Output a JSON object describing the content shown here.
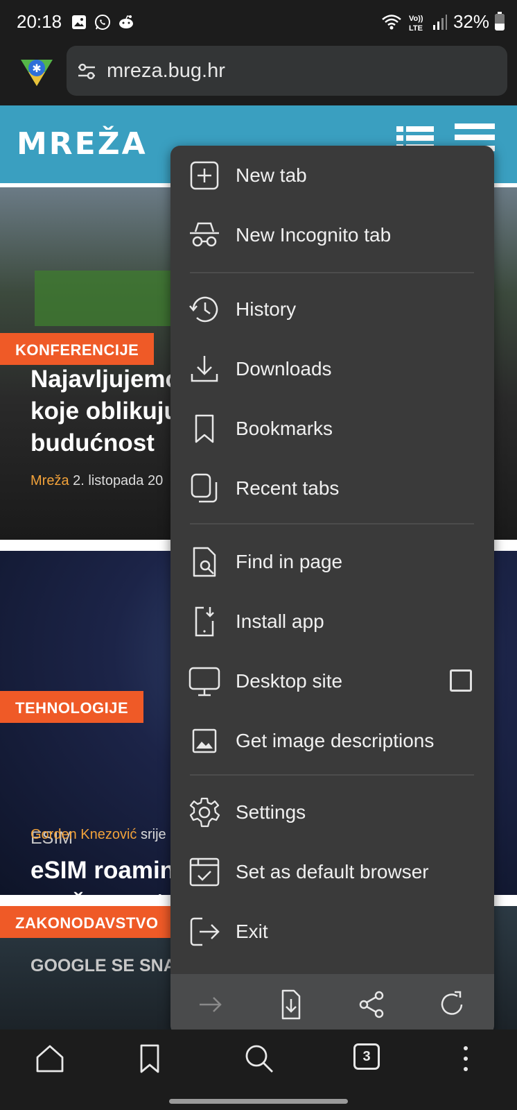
{
  "status_bar": {
    "time": "20:18",
    "battery": "32%",
    "network_label": "LTE"
  },
  "toolbar": {
    "url": "mreza.bug.hr"
  },
  "site": {
    "logo_text": "MREŽA",
    "articles": [
      {
        "category": "KONFERENCIJE",
        "title": "Najavljujemo\nkoje oblikuju\nbudućnost",
        "author": "Mreža",
        "date": " 2. listopada 20"
      },
      {
        "category": "TEHNOLOGIJE",
        "subcategory": "ESIM",
        "title": "eSIM roaming\nsnažan rast",
        "author": "Gorden Knezović",
        "date": " srije"
      },
      {
        "category": "ZAKONODAVSTVO",
        "peek_title": "GOOGLE SE SNA"
      }
    ]
  },
  "menu": {
    "items": [
      {
        "label": "New tab",
        "icon": "new-tab-icon"
      },
      {
        "label": "New Incognito tab",
        "icon": "incognito-icon"
      },
      {
        "label": "History",
        "icon": "history-icon"
      },
      {
        "label": "Downloads",
        "icon": "download-icon"
      },
      {
        "label": "Bookmarks",
        "icon": "bookmark-icon"
      },
      {
        "label": "Recent tabs",
        "icon": "recent-tabs-icon"
      },
      {
        "label": "Find in page",
        "icon": "find-in-page-icon"
      },
      {
        "label": "Install app",
        "icon": "install-app-icon"
      },
      {
        "label": "Desktop site",
        "icon": "desktop-icon",
        "checked": false
      },
      {
        "label": "Get image descriptions",
        "icon": "image-icon"
      },
      {
        "label": "Settings",
        "icon": "gear-icon"
      },
      {
        "label": "Set as default browser",
        "icon": "default-browser-icon"
      },
      {
        "label": "Exit",
        "icon": "exit-icon"
      }
    ],
    "bottom_actions": [
      "forward-icon",
      "download-page-icon",
      "share-icon",
      "reload-icon"
    ]
  },
  "bottom_nav": {
    "tab_count": "3",
    "icons": [
      "home-icon",
      "bookmark-icon",
      "search-icon",
      "tabs-icon",
      "more-vert-icon"
    ]
  },
  "colors": {
    "header_blue": "#3a9fc0",
    "tag_orange": "#ef5a27",
    "author_gold": "#f2a23a",
    "menu_bg": "#3a3a3a"
  }
}
